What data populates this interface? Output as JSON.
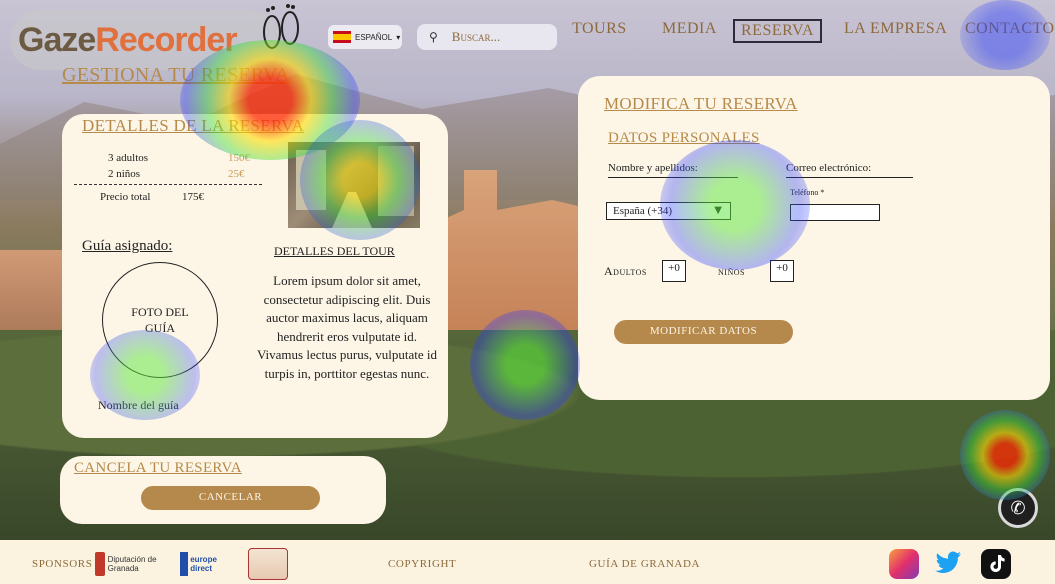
{
  "header": {
    "logo": {
      "part1": "Gaze",
      "part2": "Recorder"
    },
    "language": "ESPAÑOL",
    "search_placeholder": "Buscar...",
    "nav": [
      "TOURS",
      "MEDIA",
      "RESERVA",
      "LA EMPRESA",
      "CONTACTO"
    ],
    "active_nav": "RESERVA"
  },
  "page_title": "GESTIONA TU RESERVA",
  "details": {
    "title": "DETALLES DE LA RESERVA",
    "rows": [
      {
        "label": "3 adultos",
        "value": "150€"
      },
      {
        "label": "2 niños",
        "value": "25€"
      }
    ],
    "total_label": "Precio total",
    "total_value": "175€",
    "guide_label": "Guía asignado:",
    "guide_photo": "FOTO DEL GUÍA",
    "guide_name": "Nombre del guía",
    "tour_title": "DETALLES DEL TOUR",
    "tour_text": "Lorem ipsum dolor sit amet, consectetur adipiscing elit. Duis auctor maximus lacus, aliquam hendrerit eros vulputate id. Vivamus lectus purus, vulputate id turpis in, porttitor egestas nunc."
  },
  "modify": {
    "title": "MODIFICA TU RESERVA",
    "subtitle": "DATOS PERSONALES",
    "name_label": "Nombre y apellidos:",
    "email_label": "Correo electrónico:",
    "country_code": "España (+34)",
    "phone_label": "Teléfono *",
    "adults_label": "Adultos",
    "adults_value": "+0",
    "kids_label": "niños",
    "kids_value": "+0",
    "button": "MODIFICAR DATOS"
  },
  "cancel": {
    "title": "CANCELA TU RESERVA",
    "button": "CANCELAR"
  },
  "footer": {
    "sponsors": "SPONSORS",
    "sponsor1": "Diputación de Granada",
    "sponsor2": "europe direct",
    "copyright": "COPYRIGHT",
    "guide": "GUÍA DE GRANADA"
  },
  "colors": {
    "accent": "#b5884b",
    "panel": "#fdf6e6"
  }
}
